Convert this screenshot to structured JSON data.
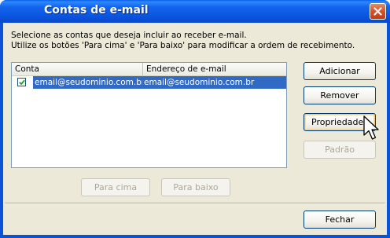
{
  "window": {
    "title": "Contas de e-mail"
  },
  "intro": {
    "line1": "Selecione as contas que deseja incluir ao receber e-mail.",
    "line2": "Utilize os botões 'Para cima' e 'Para baixo' para modificar a ordem de recebimento."
  },
  "list": {
    "columns": [
      "Conta",
      "Endereço de e-mail"
    ],
    "rows": [
      {
        "checked": true,
        "account": "email@seudominio.com.br...",
        "address": "email@seudominio.com.br"
      }
    ]
  },
  "buttons": {
    "add": "Adicionar",
    "remove": "Remover",
    "properties": "Propriedades",
    "default": "Padrão",
    "move_up": "Para cima",
    "move_down": "Para baixo",
    "close": "Fechar"
  },
  "colors": {
    "titlebar": "#0b55e0",
    "selection": "#316ac5",
    "dialog_face": "#ece9d8"
  },
  "icons": {
    "close": "close-icon",
    "check": "checkmark-icon",
    "cursor": "mouse-pointer-icon"
  }
}
